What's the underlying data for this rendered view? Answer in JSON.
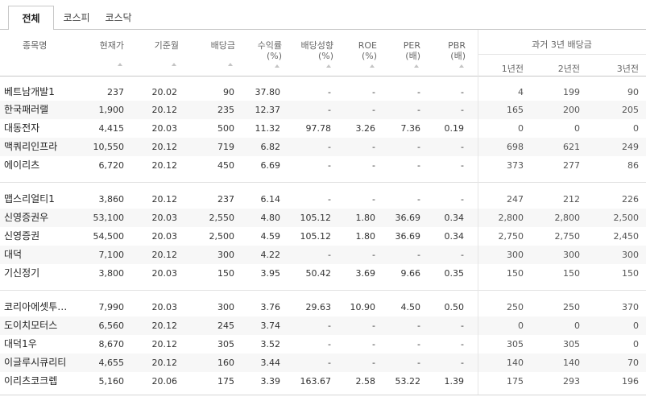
{
  "tabs": [
    {
      "label": "전체",
      "active": true
    },
    {
      "label": "코스피",
      "active": false
    },
    {
      "label": "코스닥",
      "active": false
    }
  ],
  "columns": {
    "name": "종목명",
    "price": "현재가",
    "base_month": "기준월",
    "dividend": "배당금",
    "yield_l1": "수익률",
    "yield_l2": "(%)",
    "growth_l1": "배당성향",
    "growth_l2": "(%)",
    "roe_l1": "ROE",
    "roe_l2": "(%)",
    "per_l1": "PER",
    "per_l2": "(배)",
    "pbr_l1": "PBR",
    "pbr_l2": "(배)",
    "past_title": "과거 3년 배당금",
    "y1": "1년전",
    "y2": "2년전",
    "y3": "3년전"
  },
  "rows": [
    {
      "name": "베트남개발1",
      "price": "237",
      "month": "20.02",
      "div": "90",
      "yld": "37.80",
      "payout": "-",
      "roe": "-",
      "per": "-",
      "pbr": "-",
      "y1": "4",
      "y2": "199",
      "y3": "90"
    },
    {
      "name": "한국패러랠",
      "price": "1,900",
      "month": "20.12",
      "div": "235",
      "yld": "12.37",
      "payout": "-",
      "roe": "-",
      "per": "-",
      "pbr": "-",
      "y1": "165",
      "y2": "200",
      "y3": "205"
    },
    {
      "name": "대동전자",
      "price": "4,415",
      "month": "20.03",
      "div": "500",
      "yld": "11.32",
      "payout": "97.78",
      "roe": "3.26",
      "per": "7.36",
      "pbr": "0.19",
      "y1": "0",
      "y2": "0",
      "y3": "0"
    },
    {
      "name": "맥쿼리인프라",
      "price": "10,550",
      "month": "20.12",
      "div": "719",
      "yld": "6.82",
      "payout": "-",
      "roe": "-",
      "per": "-",
      "pbr": "-",
      "y1": "698",
      "y2": "621",
      "y3": "249"
    },
    {
      "name": "에이리츠",
      "price": "6,720",
      "month": "20.12",
      "div": "450",
      "yld": "6.69",
      "payout": "-",
      "roe": "-",
      "per": "-",
      "pbr": "-",
      "y1": "373",
      "y2": "277",
      "y3": "86"
    },
    {
      "name": "맵스리얼티1",
      "price": "3,860",
      "month": "20.12",
      "div": "237",
      "yld": "6.14",
      "payout": "-",
      "roe": "-",
      "per": "-",
      "pbr": "-",
      "y1": "247",
      "y2": "212",
      "y3": "226"
    },
    {
      "name": "신영증권우",
      "price": "53,100",
      "month": "20.03",
      "div": "2,550",
      "yld": "4.80",
      "payout": "105.12",
      "roe": "1.80",
      "per": "36.69",
      "pbr": "0.34",
      "y1": "2,800",
      "y2": "2,800",
      "y3": "2,500"
    },
    {
      "name": "신영증권",
      "price": "54,500",
      "month": "20.03",
      "div": "2,500",
      "yld": "4.59",
      "payout": "105.12",
      "roe": "1.80",
      "per": "36.69",
      "pbr": "0.34",
      "y1": "2,750",
      "y2": "2,750",
      "y3": "2,450"
    },
    {
      "name": "대덕",
      "price": "7,100",
      "month": "20.12",
      "div": "300",
      "yld": "4.22",
      "payout": "-",
      "roe": "-",
      "per": "-",
      "pbr": "-",
      "y1": "300",
      "y2": "300",
      "y3": "300"
    },
    {
      "name": "기신정기",
      "price": "3,800",
      "month": "20.03",
      "div": "150",
      "yld": "3.95",
      "payout": "50.42",
      "roe": "3.69",
      "per": "9.66",
      "pbr": "0.35",
      "y1": "150",
      "y2": "150",
      "y3": "150"
    },
    {
      "name": "코리아에셋투…",
      "price": "7,990",
      "month": "20.03",
      "div": "300",
      "yld": "3.76",
      "payout": "29.63",
      "roe": "10.90",
      "per": "4.50",
      "pbr": "0.50",
      "y1": "250",
      "y2": "250",
      "y3": "370"
    },
    {
      "name": "도이치모터스",
      "price": "6,560",
      "month": "20.12",
      "div": "245",
      "yld": "3.74",
      "payout": "-",
      "roe": "-",
      "per": "-",
      "pbr": "-",
      "y1": "0",
      "y2": "0",
      "y3": "0"
    },
    {
      "name": "대덕1우",
      "price": "8,670",
      "month": "20.12",
      "div": "305",
      "yld": "3.52",
      "payout": "-",
      "roe": "-",
      "per": "-",
      "pbr": "-",
      "y1": "305",
      "y2": "305",
      "y3": "0"
    },
    {
      "name": "이글루시큐리티",
      "price": "4,655",
      "month": "20.12",
      "div": "160",
      "yld": "3.44",
      "payout": "-",
      "roe": "-",
      "per": "-",
      "pbr": "-",
      "y1": "140",
      "y2": "140",
      "y3": "70"
    },
    {
      "name": "이리츠코크렙",
      "price": "5,160",
      "month": "20.06",
      "div": "175",
      "yld": "3.39",
      "payout": "163.67",
      "roe": "2.58",
      "per": "53.22",
      "pbr": "1.39",
      "y1": "175",
      "y2": "293",
      "y3": "196"
    }
  ]
}
